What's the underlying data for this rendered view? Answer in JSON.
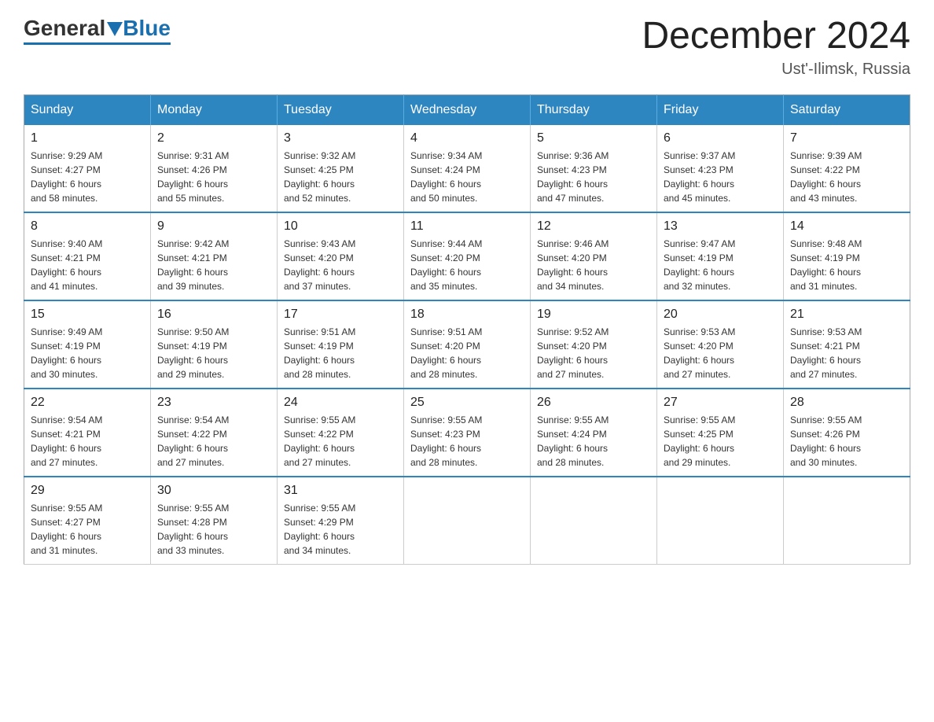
{
  "logo": {
    "general": "General",
    "blue": "Blue"
  },
  "title": "December 2024",
  "location": "Ust'-Ilimsk, Russia",
  "days_of_week": [
    "Sunday",
    "Monday",
    "Tuesday",
    "Wednesday",
    "Thursday",
    "Friday",
    "Saturday"
  ],
  "weeks": [
    [
      {
        "day": "1",
        "sunrise": "9:29 AM",
        "sunset": "4:27 PM",
        "daylight": "6 hours and 58 minutes."
      },
      {
        "day": "2",
        "sunrise": "9:31 AM",
        "sunset": "4:26 PM",
        "daylight": "6 hours and 55 minutes."
      },
      {
        "day": "3",
        "sunrise": "9:32 AM",
        "sunset": "4:25 PM",
        "daylight": "6 hours and 52 minutes."
      },
      {
        "day": "4",
        "sunrise": "9:34 AM",
        "sunset": "4:24 PM",
        "daylight": "6 hours and 50 minutes."
      },
      {
        "day": "5",
        "sunrise": "9:36 AM",
        "sunset": "4:23 PM",
        "daylight": "6 hours and 47 minutes."
      },
      {
        "day": "6",
        "sunrise": "9:37 AM",
        "sunset": "4:23 PM",
        "daylight": "6 hours and 45 minutes."
      },
      {
        "day": "7",
        "sunrise": "9:39 AM",
        "sunset": "4:22 PM",
        "daylight": "6 hours and 43 minutes."
      }
    ],
    [
      {
        "day": "8",
        "sunrise": "9:40 AM",
        "sunset": "4:21 PM",
        "daylight": "6 hours and 41 minutes."
      },
      {
        "day": "9",
        "sunrise": "9:42 AM",
        "sunset": "4:21 PM",
        "daylight": "6 hours and 39 minutes."
      },
      {
        "day": "10",
        "sunrise": "9:43 AM",
        "sunset": "4:20 PM",
        "daylight": "6 hours and 37 minutes."
      },
      {
        "day": "11",
        "sunrise": "9:44 AM",
        "sunset": "4:20 PM",
        "daylight": "6 hours and 35 minutes."
      },
      {
        "day": "12",
        "sunrise": "9:46 AM",
        "sunset": "4:20 PM",
        "daylight": "6 hours and 34 minutes."
      },
      {
        "day": "13",
        "sunrise": "9:47 AM",
        "sunset": "4:19 PM",
        "daylight": "6 hours and 32 minutes."
      },
      {
        "day": "14",
        "sunrise": "9:48 AM",
        "sunset": "4:19 PM",
        "daylight": "6 hours and 31 minutes."
      }
    ],
    [
      {
        "day": "15",
        "sunrise": "9:49 AM",
        "sunset": "4:19 PM",
        "daylight": "6 hours and 30 minutes."
      },
      {
        "day": "16",
        "sunrise": "9:50 AM",
        "sunset": "4:19 PM",
        "daylight": "6 hours and 29 minutes."
      },
      {
        "day": "17",
        "sunrise": "9:51 AM",
        "sunset": "4:19 PM",
        "daylight": "6 hours and 28 minutes."
      },
      {
        "day": "18",
        "sunrise": "9:51 AM",
        "sunset": "4:20 PM",
        "daylight": "6 hours and 28 minutes."
      },
      {
        "day": "19",
        "sunrise": "9:52 AM",
        "sunset": "4:20 PM",
        "daylight": "6 hours and 27 minutes."
      },
      {
        "day": "20",
        "sunrise": "9:53 AM",
        "sunset": "4:20 PM",
        "daylight": "6 hours and 27 minutes."
      },
      {
        "day": "21",
        "sunrise": "9:53 AM",
        "sunset": "4:21 PM",
        "daylight": "6 hours and 27 minutes."
      }
    ],
    [
      {
        "day": "22",
        "sunrise": "9:54 AM",
        "sunset": "4:21 PM",
        "daylight": "6 hours and 27 minutes."
      },
      {
        "day": "23",
        "sunrise": "9:54 AM",
        "sunset": "4:22 PM",
        "daylight": "6 hours and 27 minutes."
      },
      {
        "day": "24",
        "sunrise": "9:55 AM",
        "sunset": "4:22 PM",
        "daylight": "6 hours and 27 minutes."
      },
      {
        "day": "25",
        "sunrise": "9:55 AM",
        "sunset": "4:23 PM",
        "daylight": "6 hours and 28 minutes."
      },
      {
        "day": "26",
        "sunrise": "9:55 AM",
        "sunset": "4:24 PM",
        "daylight": "6 hours and 28 minutes."
      },
      {
        "day": "27",
        "sunrise": "9:55 AM",
        "sunset": "4:25 PM",
        "daylight": "6 hours and 29 minutes."
      },
      {
        "day": "28",
        "sunrise": "9:55 AM",
        "sunset": "4:26 PM",
        "daylight": "6 hours and 30 minutes."
      }
    ],
    [
      {
        "day": "29",
        "sunrise": "9:55 AM",
        "sunset": "4:27 PM",
        "daylight": "6 hours and 31 minutes."
      },
      {
        "day": "30",
        "sunrise": "9:55 AM",
        "sunset": "4:28 PM",
        "daylight": "6 hours and 33 minutes."
      },
      {
        "day": "31",
        "sunrise": "9:55 AM",
        "sunset": "4:29 PM",
        "daylight": "6 hours and 34 minutes."
      },
      null,
      null,
      null,
      null
    ]
  ],
  "labels": {
    "sunrise": "Sunrise:",
    "sunset": "Sunset:",
    "daylight": "Daylight:"
  }
}
